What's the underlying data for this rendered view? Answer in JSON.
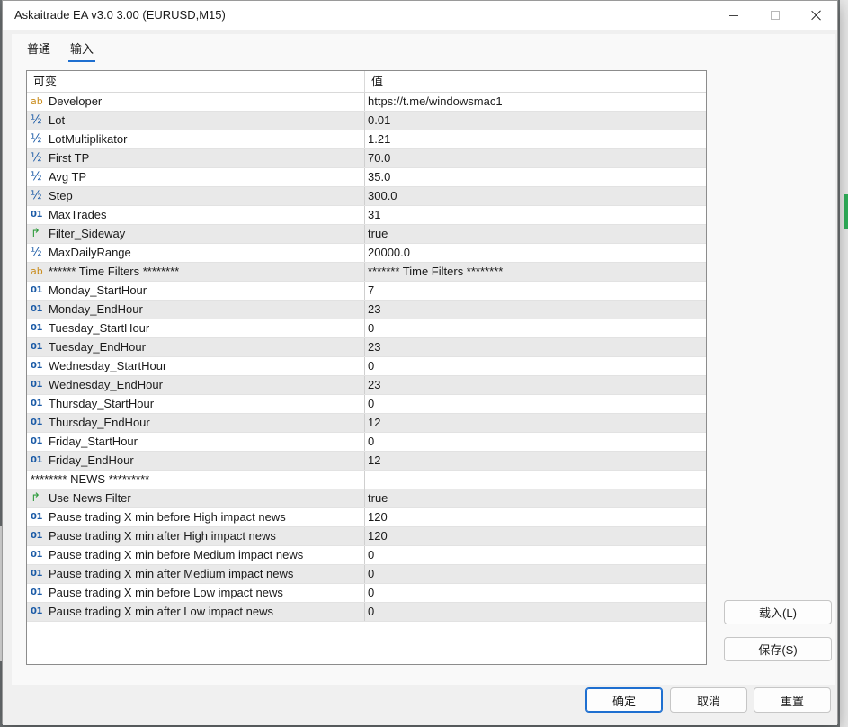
{
  "window": {
    "title": "Askaitrade EA v3.0 3.00 (EURUSD,M15)"
  },
  "tabs": [
    {
      "label": "普通",
      "active": false
    },
    {
      "label": "输入",
      "active": true
    }
  ],
  "grid": {
    "headers": {
      "variable": "可变",
      "value": "值"
    },
    "icons": {
      "str": "ab",
      "dbl": "½",
      "int": "01",
      "bool": "↱"
    },
    "rows": [
      {
        "icon": "str",
        "name": "Developer",
        "value": "https://t.me/windowsmac1"
      },
      {
        "icon": "dbl",
        "name": "Lot",
        "value": "0.01"
      },
      {
        "icon": "dbl",
        "name": "LotMultiplikator",
        "value": "1.21"
      },
      {
        "icon": "dbl",
        "name": "First TP",
        "value": "70.0"
      },
      {
        "icon": "dbl",
        "name": "Avg TP",
        "value": "35.0"
      },
      {
        "icon": "dbl",
        "name": "Step",
        "value": "300.0"
      },
      {
        "icon": "int",
        "name": "MaxTrades",
        "value": "31"
      },
      {
        "icon": "bool",
        "name": "Filter_Sideway",
        "value": "true"
      },
      {
        "icon": "dbl",
        "name": "MaxDailyRange",
        "value": "20000.0"
      },
      {
        "icon": "str",
        "name": "****** Time Filters ********",
        "value": "******* Time Filters ********"
      },
      {
        "icon": "int",
        "name": "Monday_StartHour",
        "value": "7"
      },
      {
        "icon": "int",
        "name": "Monday_EndHour",
        "value": "23"
      },
      {
        "icon": "int",
        "name": "Tuesday_StartHour",
        "value": "0"
      },
      {
        "icon": "int",
        "name": "Tuesday_EndHour",
        "value": "23"
      },
      {
        "icon": "int",
        "name": "Wednesday_StartHour",
        "value": "0"
      },
      {
        "icon": "int",
        "name": "Wednesday_EndHour",
        "value": "23"
      },
      {
        "icon": "int",
        "name": "Thursday_StartHour",
        "value": "0"
      },
      {
        "icon": "int",
        "name": "Thursday_EndHour",
        "value": "12"
      },
      {
        "icon": "int",
        "name": "Friday_StartHour",
        "value": "0"
      },
      {
        "icon": "int",
        "name": "Friday_EndHour",
        "value": "12"
      },
      {
        "icon": "none",
        "name": "******** NEWS *********",
        "value": ""
      },
      {
        "icon": "bool",
        "name": "Use News Filter",
        "value": "true"
      },
      {
        "icon": "int",
        "name": "Pause trading X min before High impact news",
        "value": "120"
      },
      {
        "icon": "int",
        "name": "Pause trading X min after High impact news",
        "value": "120"
      },
      {
        "icon": "int",
        "name": "Pause trading X min before Medium impact news",
        "value": "0"
      },
      {
        "icon": "int",
        "name": "Pause trading X min after Medium impact news",
        "value": "0"
      },
      {
        "icon": "int",
        "name": "Pause trading X min before Low impact news",
        "value": "0"
      },
      {
        "icon": "int",
        "name": "Pause trading X min after Low impact news",
        "value": "0"
      }
    ]
  },
  "buttons": {
    "load": "载入(L)",
    "save": "保存(S)",
    "ok": "确定",
    "cancel": "取消",
    "reset": "重置"
  },
  "colors": {
    "accent": "#1e6fd0",
    "string_icon": "#c88a18",
    "number_icon": "#1a5aa6",
    "bool_icon": "#2e9b3c"
  }
}
